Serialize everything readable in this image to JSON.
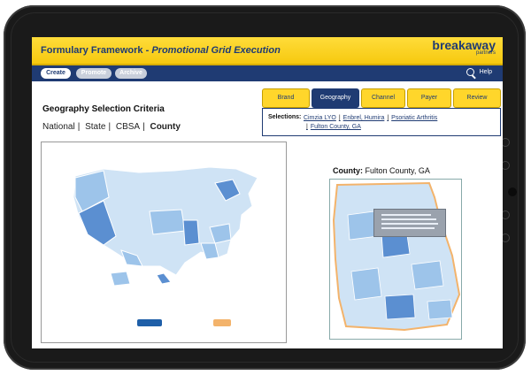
{
  "app": {
    "title": "Formulary Framework - ",
    "subtitle": "Promotional Grid Execution",
    "logo_main": "breakaway",
    "logo_sub": "partners"
  },
  "nav": {
    "create": "Create",
    "promote": "Promote",
    "archive": "Archive",
    "help": "Help"
  },
  "criteria": {
    "title": "Geography Selection Criteria",
    "levels": [
      "National",
      "State",
      "CBSA",
      "County"
    ],
    "active_level": "County"
  },
  "tabs": [
    "Brand",
    "Geography",
    "Channel",
    "Payer",
    "Review"
  ],
  "active_tab": "Geography",
  "selections": {
    "label": "Selections:",
    "items": [
      "Cimzia LYO",
      "Enbrel, Humira",
      "Psoriatic Arthritis",
      "Fulton County, GA"
    ]
  },
  "county": {
    "label": "County:",
    "value": "Fulton County, GA"
  },
  "colors": {
    "header_yellow": "#f6c90f",
    "nav_blue": "#1f3b73",
    "map_light": "#cfe3f5",
    "map_mid": "#9dc4ea",
    "map_dark": "#5b8fd1"
  }
}
